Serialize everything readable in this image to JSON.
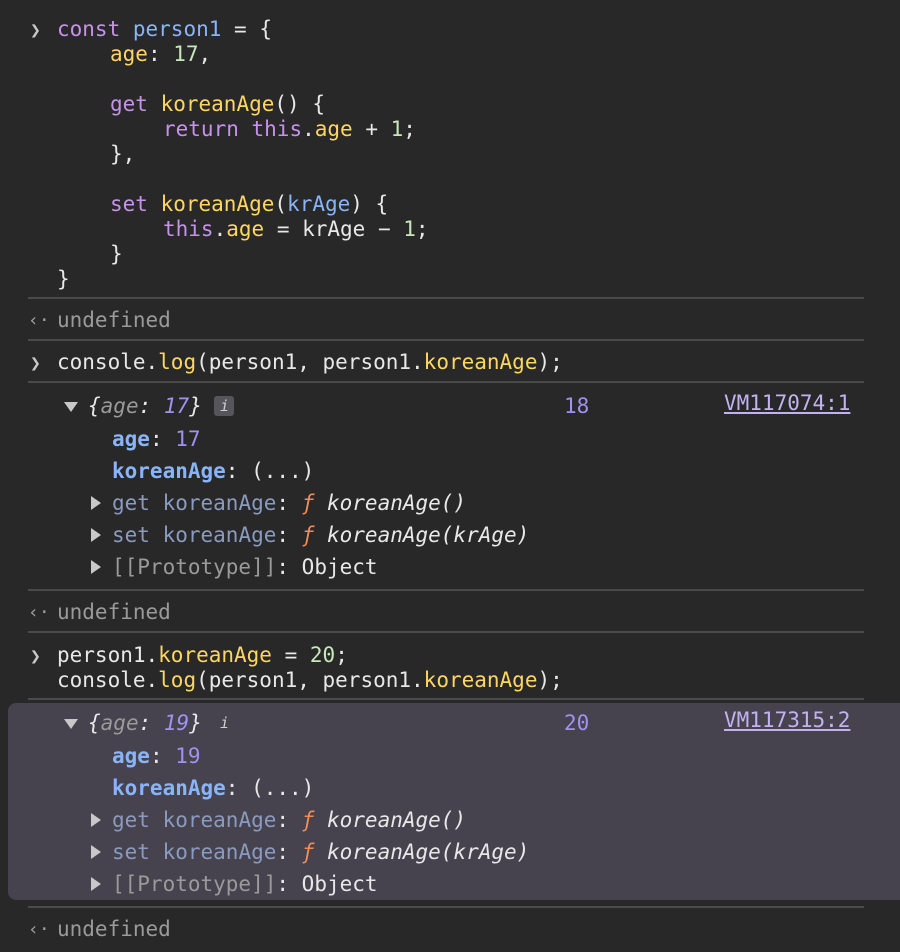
{
  "code1": {
    "c1": "const",
    "c2": "person1",
    "c3": "age",
    "c4": "17",
    "c5": "get",
    "c6": "koreanAge",
    "c7": "return",
    "c8": "this",
    "c9": "age",
    "c10": "1",
    "c11": "set",
    "c12": "koreanAge",
    "c13": "krAge",
    "c14": "this",
    "c15": "age",
    "c16": "krAge",
    "c17": "1"
  },
  "return1": "undefined",
  "cmd2": {
    "a": "console.",
    "b": "log",
    "c": "(person1, person1.",
    "d": "koreanAge",
    "e": ");"
  },
  "obj1": {
    "preview_key": "age",
    "preview_val": "17",
    "info_badge": "i",
    "result": "18",
    "source": "VM117074:1",
    "age_key": "age",
    "age_val": "17",
    "korean_key": "koreanAge",
    "korean_val": "(...)",
    "get_label": "get",
    "get_key": "koreanAge",
    "get_fn": "koreanAge()",
    "set_label": "set",
    "set_key": "koreanAge",
    "set_fn": "koreanAge(krAge)",
    "proto_key": "[[Prototype]]",
    "proto_val": "Object",
    "fsym": "ƒ"
  },
  "return2": "undefined",
  "cmd3": {
    "a": "person1.",
    "b": "koreanAge",
    "c": " = ",
    "d": "20",
    "e": ";",
    "f": "console.",
    "g": "log",
    "h": "(person1, person1.",
    "i": "koreanAge",
    "j": ");"
  },
  "obj2": {
    "preview_key": "age",
    "preview_val": "19",
    "info_badge": "i",
    "result": "20",
    "source": "VM117315:2",
    "age_key": "age",
    "age_val": "19",
    "korean_key": "koreanAge",
    "korean_val": "(...)",
    "get_label": "get",
    "get_key": "koreanAge",
    "get_fn": "koreanAge()",
    "set_label": "set",
    "set_key": "koreanAge",
    "set_fn": "koreanAge(krAge)",
    "proto_key": "[[Prototype]]",
    "proto_val": "Object",
    "fsym": "ƒ"
  },
  "return3": "undefined",
  "icons": {
    "prompt": "chevron-right-icon",
    "return": "return-arrow-icon"
  },
  "colors": {
    "background": "#282828",
    "highlight": "#46434f",
    "keyword": "#c792ea",
    "property": "#fdd663",
    "number": "#c7e9ba"
  }
}
